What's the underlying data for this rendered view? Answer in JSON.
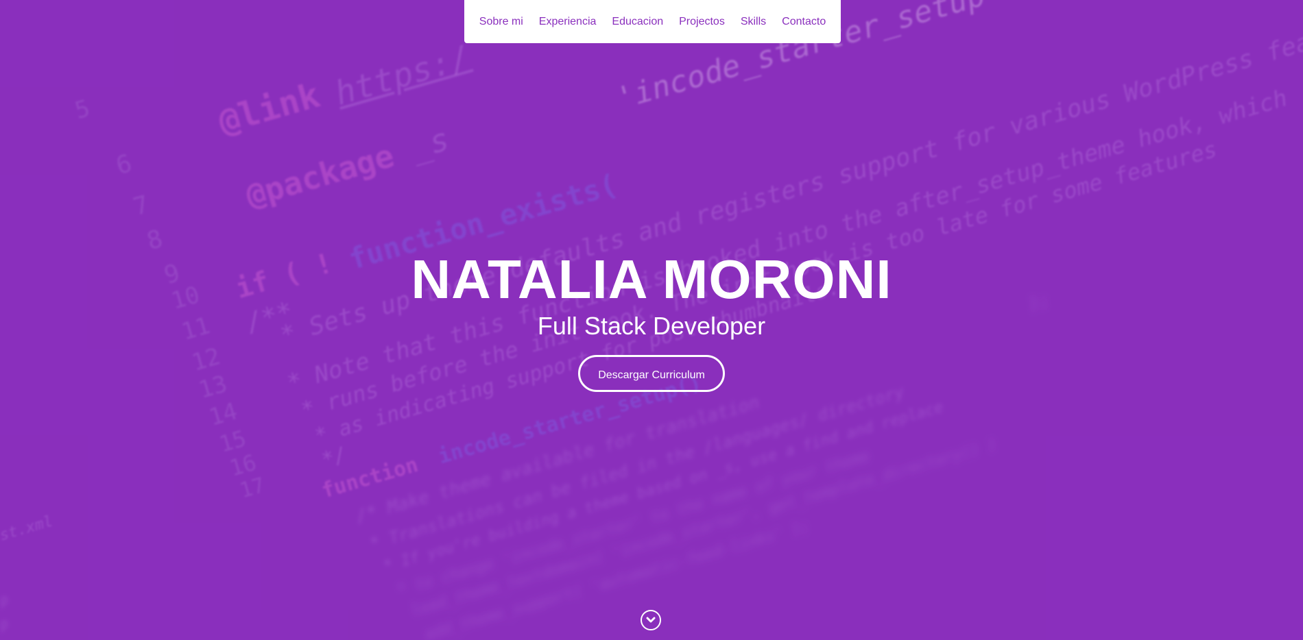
{
  "nav": {
    "items": [
      {
        "label": "Sobre mi"
      },
      {
        "label": "Experiencia"
      },
      {
        "label": "Educacion"
      },
      {
        "label": "Projectos"
      },
      {
        "label": "Skills"
      },
      {
        "label": "Contacto"
      }
    ]
  },
  "hero": {
    "name": "NATALIA MORONI",
    "subtitle": "Full Stack Developer",
    "cv_button": "Descargar Curriculum",
    "scroll_icon": "chevron-down-circle-icon"
  },
  "colors": {
    "background": "#8a2fbd",
    "nav_bg": "#ffffff",
    "nav_text": "#8a2fbd",
    "hero_text": "#ffffff"
  }
}
